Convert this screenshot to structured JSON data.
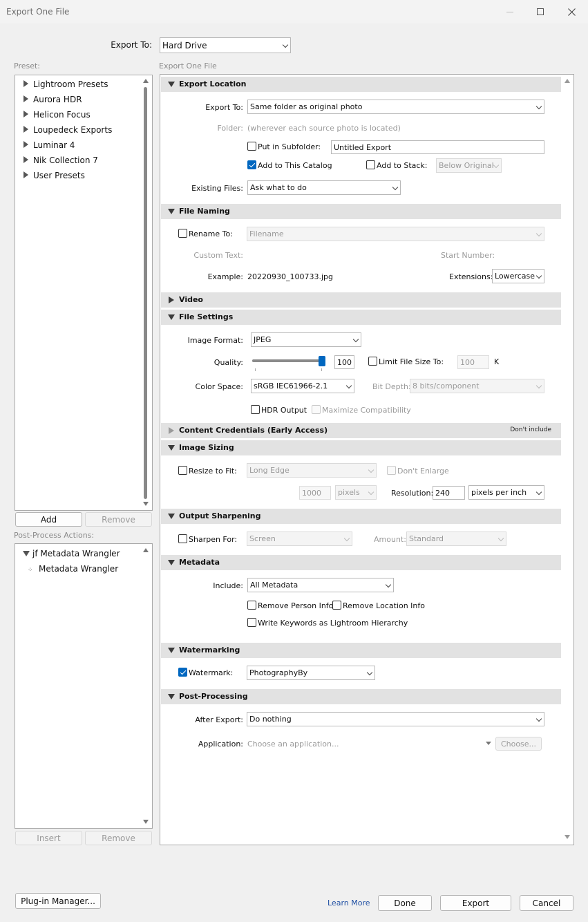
{
  "window": {
    "title": "Export One File",
    "minimize_icon": "minimize-icon",
    "maximize_icon": "maximize-icon",
    "close_icon": "close-icon"
  },
  "export_to": {
    "label": "Export To:",
    "value": "Hard Drive"
  },
  "preset": {
    "label": "Preset:",
    "items": [
      "Lightroom Presets",
      "Aurora HDR",
      "Helicon Focus",
      "Loupedeck Exports",
      "Luminar 4",
      "Nik Collection 7",
      "User Presets"
    ],
    "add": "Add",
    "remove": "Remove"
  },
  "post_process_actions": {
    "label": "Post-Process Actions:",
    "group": "jf Metadata Wrangler",
    "child": "Metadata Wrangler",
    "insert": "Insert",
    "remove": "Remove"
  },
  "export_one_file_label": "Export One File",
  "sections": {
    "export_location": {
      "title": "Export Location",
      "export_to_label": "Export To:",
      "export_to_value": "Same folder as original photo",
      "folder_label": "Folder:",
      "folder_value": "(wherever each source photo is located)",
      "put_in_subfolder": "Put in Subfolder:",
      "subfolder_value": "Untitled Export",
      "add_to_catalog": "Add to This Catalog",
      "add_to_stack": "Add to Stack:",
      "stack_value": "Below Original",
      "existing_files_label": "Existing Files:",
      "existing_files_value": "Ask what to do"
    },
    "file_naming": {
      "title": "File Naming",
      "rename_to": "Rename To:",
      "rename_value": "Filename",
      "custom_text_label": "Custom Text:",
      "start_number_label": "Start Number:",
      "example_label": "Example:",
      "example_value": "20220930_100733.jpg",
      "extensions_label": "Extensions:",
      "extensions_value": "Lowercase"
    },
    "video": {
      "title": "Video"
    },
    "file_settings": {
      "title": "File Settings",
      "image_format_label": "Image Format:",
      "image_format_value": "JPEG",
      "quality_label": "Quality:",
      "quality_value": "100",
      "quality_fraction": 1.0,
      "limit_file_size": "Limit File Size To:",
      "limit_value": "100",
      "limit_unit": "K",
      "color_space_label": "Color Space:",
      "color_space_value": "sRGB IEC61966-2.1",
      "bit_depth_label": "Bit Depth:",
      "bit_depth_value": "8 bits/component",
      "hdr_output": "HDR Output",
      "maximize_compat": "Maximize Compatibility"
    },
    "content_credentials": {
      "title": "Content Credentials (Early Access)",
      "status": "Don't include"
    },
    "image_sizing": {
      "title": "Image Sizing",
      "resize_to_fit": "Resize to Fit:",
      "resize_value": "Long Edge",
      "dont_enlarge": "Don't Enlarge",
      "size_value": "1000",
      "size_unit": "pixels",
      "resolution_label": "Resolution:",
      "resolution_value": "240",
      "resolution_unit": "pixels per inch"
    },
    "output_sharpening": {
      "title": "Output Sharpening",
      "sharpen_for": "Sharpen For:",
      "sharpen_value": "Screen",
      "amount_label": "Amount:",
      "amount_value": "Standard"
    },
    "metadata": {
      "title": "Metadata",
      "include_label": "Include:",
      "include_value": "All Metadata",
      "remove_person": "Remove Person Info",
      "remove_location": "Remove Location Info",
      "write_keywords": "Write Keywords as Lightroom Hierarchy"
    },
    "watermarking": {
      "title": "Watermarking",
      "watermark_label": "Watermark:",
      "watermark_value": "PhotographyBy"
    },
    "post_processing": {
      "title": "Post-Processing",
      "after_export_label": "After Export:",
      "after_export_value": "Do nothing",
      "application_label": "Application:",
      "application_placeholder": "Choose an application...",
      "choose": "Choose..."
    }
  },
  "footer": {
    "plugin_manager": "Plug-in Manager...",
    "learn_more": "Learn More",
    "done": "Done",
    "export": "Export",
    "cancel": "Cancel"
  },
  "colors": {
    "accent": "#0067c0",
    "header": "#e2e2e2",
    "link": "#1f4fa3"
  }
}
